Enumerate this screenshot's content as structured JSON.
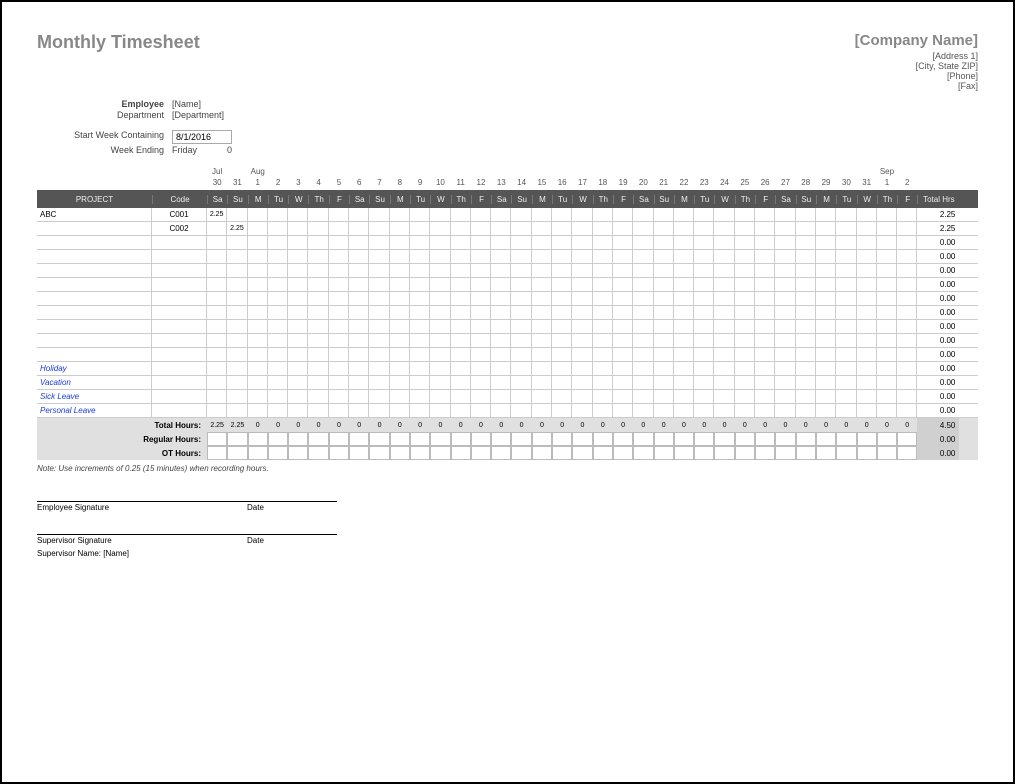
{
  "title": "Monthly Timesheet",
  "company": {
    "name": "[Company Name]",
    "address1": "[Address 1]",
    "address2": "[City, State ZIP]",
    "phone": "[Phone]",
    "fax": "[Fax]"
  },
  "info": {
    "employee_label": "Employee",
    "employee_value": "[Name]",
    "department_label": "Department",
    "department_value": "[Department]",
    "start_week_label": "Start Week Containing",
    "start_week_value": "8/1/2016",
    "week_ending_label": "Week Ending",
    "week_ending_value": "Friday",
    "week_ending_extra": "0"
  },
  "months": {
    "jul": "Jul",
    "aug": "Aug",
    "sep": "Sep"
  },
  "day_nums": [
    "30",
    "31",
    "1",
    "2",
    "3",
    "4",
    "5",
    "6",
    "7",
    "8",
    "9",
    "10",
    "11",
    "12",
    "13",
    "14",
    "15",
    "16",
    "17",
    "18",
    "19",
    "20",
    "21",
    "22",
    "23",
    "24",
    "25",
    "26",
    "27",
    "28",
    "29",
    "30",
    "31",
    "1",
    "2"
  ],
  "day_names": [
    "Sa",
    "Su",
    "M",
    "Tu",
    "W",
    "Th",
    "F",
    "Sa",
    "Su",
    "M",
    "Tu",
    "W",
    "Th",
    "F",
    "Sa",
    "Su",
    "M",
    "Tu",
    "W",
    "Th",
    "F",
    "Sa",
    "Su",
    "M",
    "Tu",
    "W",
    "Th",
    "F",
    "Sa",
    "Su",
    "M",
    "Tu",
    "W",
    "Th",
    "F"
  ],
  "headers": {
    "project": "PROJECT",
    "code": "Code",
    "total_hrs": "Total Hrs"
  },
  "rows": [
    {
      "project": "ABC",
      "code": "C001",
      "cells": [
        "2.25",
        "",
        "",
        "",
        "",
        "",
        "",
        "",
        "",
        "",
        "",
        "",
        "",
        "",
        "",
        "",
        "",
        "",
        "",
        "",
        "",
        "",
        "",
        "",
        "",
        "",
        "",
        "",
        "",
        "",
        "",
        "",
        "",
        "",
        ""
      ],
      "total": "2.25"
    },
    {
      "project": "",
      "code": "C002",
      "cells": [
        "",
        "2.25",
        "",
        "",
        "",
        "",
        "",
        "",
        "",
        "",
        "",
        "",
        "",
        "",
        "",
        "",
        "",
        "",
        "",
        "",
        "",
        "",
        "",
        "",
        "",
        "",
        "",
        "",
        "",
        "",
        "",
        "",
        "",
        "",
        ""
      ],
      "total": "2.25"
    },
    {
      "project": "",
      "code": "",
      "cells": [
        "",
        "",
        "",
        "",
        "",
        "",
        "",
        "",
        "",
        "",
        "",
        "",
        "",
        "",
        "",
        "",
        "",
        "",
        "",
        "",
        "",
        "",
        "",
        "",
        "",
        "",
        "",
        "",
        "",
        "",
        "",
        "",
        "",
        "",
        ""
      ],
      "total": "0.00"
    },
    {
      "project": "",
      "code": "",
      "cells": [
        "",
        "",
        "",
        "",
        "",
        "",
        "",
        "",
        "",
        "",
        "",
        "",
        "",
        "",
        "",
        "",
        "",
        "",
        "",
        "",
        "",
        "",
        "",
        "",
        "",
        "",
        "",
        "",
        "",
        "",
        "",
        "",
        "",
        "",
        ""
      ],
      "total": "0.00"
    },
    {
      "project": "",
      "code": "",
      "cells": [
        "",
        "",
        "",
        "",
        "",
        "",
        "",
        "",
        "",
        "",
        "",
        "",
        "",
        "",
        "",
        "",
        "",
        "",
        "",
        "",
        "",
        "",
        "",
        "",
        "",
        "",
        "",
        "",
        "",
        "",
        "",
        "",
        "",
        "",
        ""
      ],
      "total": "0.00"
    },
    {
      "project": "",
      "code": "",
      "cells": [
        "",
        "",
        "",
        "",
        "",
        "",
        "",
        "",
        "",
        "",
        "",
        "",
        "",
        "",
        "",
        "",
        "",
        "",
        "",
        "",
        "",
        "",
        "",
        "",
        "",
        "",
        "",
        "",
        "",
        "",
        "",
        "",
        "",
        "",
        ""
      ],
      "total": "0.00"
    },
    {
      "project": "",
      "code": "",
      "cells": [
        "",
        "",
        "",
        "",
        "",
        "",
        "",
        "",
        "",
        "",
        "",
        "",
        "",
        "",
        "",
        "",
        "",
        "",
        "",
        "",
        "",
        "",
        "",
        "",
        "",
        "",
        "",
        "",
        "",
        "",
        "",
        "",
        "",
        "",
        ""
      ],
      "total": "0.00"
    },
    {
      "project": "",
      "code": "",
      "cells": [
        "",
        "",
        "",
        "",
        "",
        "",
        "",
        "",
        "",
        "",
        "",
        "",
        "",
        "",
        "",
        "",
        "",
        "",
        "",
        "",
        "",
        "",
        "",
        "",
        "",
        "",
        "",
        "",
        "",
        "",
        "",
        "",
        "",
        "",
        ""
      ],
      "total": "0.00"
    },
    {
      "project": "",
      "code": "",
      "cells": [
        "",
        "",
        "",
        "",
        "",
        "",
        "",
        "",
        "",
        "",
        "",
        "",
        "",
        "",
        "",
        "",
        "",
        "",
        "",
        "",
        "",
        "",
        "",
        "",
        "",
        "",
        "",
        "",
        "",
        "",
        "",
        "",
        "",
        "",
        ""
      ],
      "total": "0.00"
    },
    {
      "project": "",
      "code": "",
      "cells": [
        "",
        "",
        "",
        "",
        "",
        "",
        "",
        "",
        "",
        "",
        "",
        "",
        "",
        "",
        "",
        "",
        "",
        "",
        "",
        "",
        "",
        "",
        "",
        "",
        "",
        "",
        "",
        "",
        "",
        "",
        "",
        "",
        "",
        "",
        ""
      ],
      "total": "0.00"
    },
    {
      "project": "",
      "code": "",
      "cells": [
        "",
        "",
        "",
        "",
        "",
        "",
        "",
        "",
        "",
        "",
        "",
        "",
        "",
        "",
        "",
        "",
        "",
        "",
        "",
        "",
        "",
        "",
        "",
        "",
        "",
        "",
        "",
        "",
        "",
        "",
        "",
        "",
        "",
        "",
        ""
      ],
      "total": "0.00"
    }
  ],
  "leave_rows": [
    {
      "project": "Holiday",
      "total": "0.00"
    },
    {
      "project": "Vacation",
      "total": "0.00"
    },
    {
      "project": "Sick Leave",
      "total": "0.00"
    },
    {
      "project": "Personal Leave",
      "total": "0.00"
    }
  ],
  "summary": {
    "total_hours_label": "Total Hours:",
    "total_hours_cells": [
      "2.25",
      "2.25",
      "0",
      "0",
      "0",
      "0",
      "0",
      "0",
      "0",
      "0",
      "0",
      "0",
      "0",
      "0",
      "0",
      "0",
      "0",
      "0",
      "0",
      "0",
      "0",
      "0",
      "0",
      "0",
      "0",
      "0",
      "0",
      "0",
      "0",
      "0",
      "0",
      "0",
      "0",
      "0",
      "0"
    ],
    "total_hours_total": "4.50",
    "regular_label": "Regular Hours:",
    "regular_total": "0.00",
    "ot_label": "OT Hours:",
    "ot_total": "0.00"
  },
  "note": "Note: Use increments of 0.25 (15 minutes) when recording hours.",
  "signatures": {
    "emp_sig": "Employee Signature",
    "date": "Date",
    "sup_sig": "Supervisor Signature",
    "sup_name_label": "Supervisor Name: [Name]"
  }
}
